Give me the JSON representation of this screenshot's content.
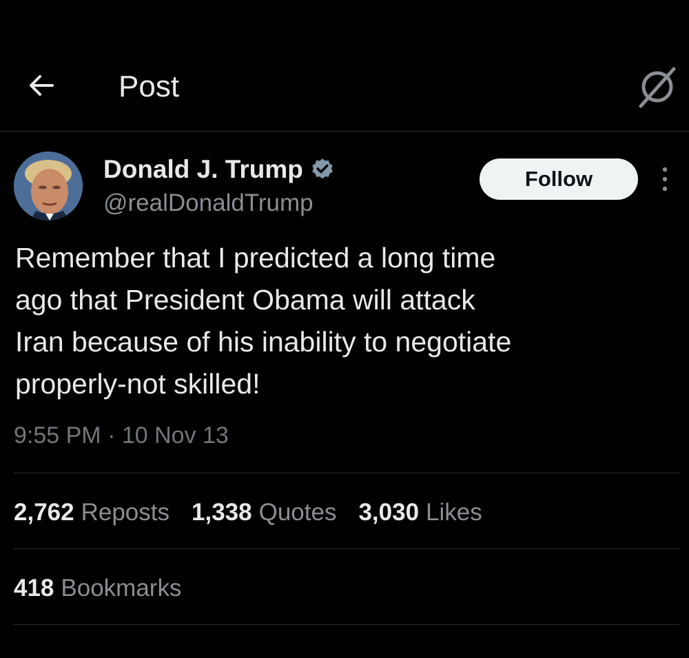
{
  "header": {
    "title": "Post",
    "back_icon": "arrow-left-icon",
    "grok_icon": "grok-icon"
  },
  "author": {
    "display_name": "Donald J. Trump",
    "handle": "@realDonaldTrump",
    "verified_icon": "verified-badge-icon",
    "follow_label": "Follow",
    "more_icon": "more-vertical-icon"
  },
  "tweet": {
    "text": "Remember that I predicted a long time\nago that President Obama will attack\nIran because of his inability to negotiate\nproperly-not skilled!",
    "timestamp": "9:55 PM · 10 Nov 13"
  },
  "stats": {
    "reposts_count": "2,762",
    "reposts_label": "Reposts",
    "quotes_count": "1,338",
    "quotes_label": "Quotes",
    "likes_count": "3,030",
    "likes_label": "Likes",
    "bookmarks_count": "418",
    "bookmarks_label": "Bookmarks"
  },
  "colors": {
    "background": "#000000",
    "text_primary": "#e7e9ea",
    "text_secondary": "#71767b",
    "divider": "#2a2d31",
    "follow_bg": "#eff3f4",
    "verified": "#829aab"
  }
}
